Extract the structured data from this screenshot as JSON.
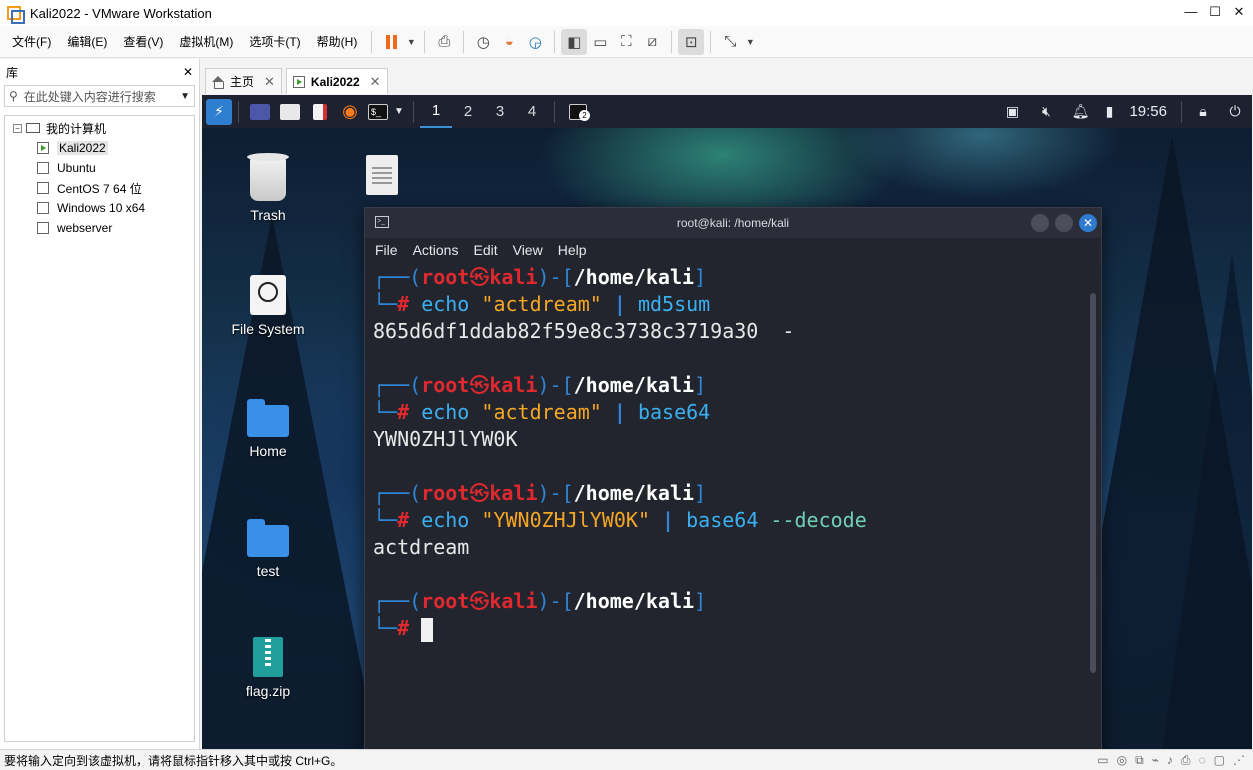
{
  "window": {
    "title": "Kali2022 - VMware Workstation",
    "controls": [
      "—",
      "☐",
      "✕"
    ]
  },
  "menubar": {
    "items": [
      "文件(F)",
      "编辑(E)",
      "查看(V)",
      "虚拟机(M)",
      "选项卡(T)",
      "帮助(H)"
    ]
  },
  "library": {
    "title": "库",
    "close": "✕",
    "search_placeholder": "在此处键入内容进行搜索",
    "tree": {
      "root": "我的计算机",
      "toggle": "−",
      "vms": [
        "Kali2022",
        "Ubuntu",
        "CentOS 7 64 位",
        "Windows 10 x64",
        "webserver"
      ],
      "selected": "Kali2022"
    }
  },
  "tabs": [
    {
      "label": "主页",
      "icon": "home-icon"
    },
    {
      "label": "Kali2022",
      "icon": "vm-icon",
      "active": true
    }
  ],
  "kali_panel": {
    "workspaces": [
      "1",
      "2",
      "3",
      "4"
    ],
    "active_workspace": "1",
    "badge": "2",
    "clock": "19:56"
  },
  "desktop": {
    "icons": [
      "Trash",
      "File System",
      "Home",
      "test",
      "flag.zip"
    ]
  },
  "terminal": {
    "title": "root@kali: /home/kali",
    "menu": [
      "File",
      "Actions",
      "Edit",
      "View",
      "Help"
    ],
    "prompt_user": "root",
    "prompt_host": "kali",
    "prompt_path": "/home/kali",
    "cmd1": {
      "cmd": "echo",
      "arg": "\"actdream\"",
      "pipe": "|",
      "tool": "md5sum",
      "output": "865d6df1ddab82f59e8c3738c3719a30  -"
    },
    "cmd2": {
      "cmd": "echo",
      "arg": "\"actdream\"",
      "pipe": "|",
      "tool": "base64",
      "output": "YWN0ZHJlYW0K"
    },
    "cmd3": {
      "cmd": "echo",
      "arg": "\"YWN0ZHJlYW0K\"",
      "pipe": "|",
      "tool": "base64",
      "opt": "--decode",
      "output": "actdream"
    }
  },
  "statusbar": {
    "text": "要将输入定向到该虚拟机，请将鼠标指针移入其中或按 Ctrl+G。"
  }
}
